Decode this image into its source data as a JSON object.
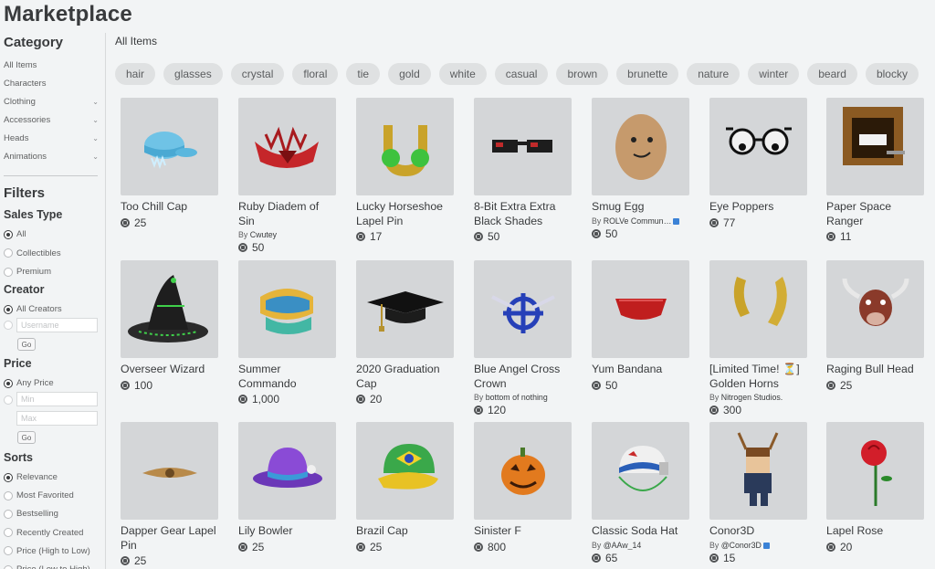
{
  "page": {
    "title": "Marketplace",
    "heading": "All Items"
  },
  "sidebar": {
    "category_title": "Category",
    "categories": [
      {
        "label": "All Items",
        "chevron": false
      },
      {
        "label": "Characters",
        "chevron": false
      },
      {
        "label": "Clothing",
        "chevron": true
      },
      {
        "label": "Accessories",
        "chevron": true
      },
      {
        "label": "Heads",
        "chevron": true
      },
      {
        "label": "Animations",
        "chevron": true
      }
    ],
    "filters_title": "Filters",
    "sales_type": {
      "title": "Sales Type",
      "options": [
        "All",
        "Collectibles",
        "Premium"
      ],
      "selected": "All"
    },
    "creator": {
      "title": "Creator",
      "options": [
        "All Creators"
      ],
      "selected": "All Creators",
      "username_placeholder": "Username",
      "go_label": "Go"
    },
    "price": {
      "title": "Price",
      "options": [
        "Any Price"
      ],
      "selected": "Any Price",
      "min_placeholder": "Min",
      "max_placeholder": "Max",
      "go_label": "Go"
    },
    "sorts": {
      "title": "Sorts",
      "options": [
        "Relevance",
        "Most Favorited",
        "Bestselling",
        "Recently Created",
        "Price (High to Low)",
        "Price (Low to High)"
      ],
      "selected": "Relevance"
    }
  },
  "tags": [
    "hair",
    "glasses",
    "crystal",
    "floral",
    "tie",
    "gold",
    "white",
    "casual",
    "brown",
    "brunette",
    "nature",
    "winter",
    "beard",
    "blocky"
  ],
  "items": [
    {
      "name": "Too Chill Cap",
      "creator": "",
      "price": "25",
      "icon": "cap-icon"
    },
    {
      "name": "Ruby Diadem of Sin",
      "creator": "Cwutey",
      "price": "50",
      "icon": "diadem-icon"
    },
    {
      "name": "Lucky Horseshoe Lapel Pin",
      "creator": "",
      "price": "17",
      "icon": "horseshoe-icon"
    },
    {
      "name": "8-Bit Extra Extra Black Shades",
      "creator": "",
      "price": "50",
      "icon": "shades-icon"
    },
    {
      "name": "Smug Egg",
      "creator": "ROLVe Commun…",
      "verified": true,
      "price": "50",
      "icon": "egg-icon"
    },
    {
      "name": "Eye Poppers",
      "creator": "",
      "price": "77",
      "icon": "glasses-icon"
    },
    {
      "name": "Paper Space Ranger",
      "creator": "",
      "price": "11",
      "icon": "box-helmet-icon"
    },
    {
      "name": "Overseer Wizard",
      "creator": "",
      "price": "100",
      "icon": "wizard-hat-icon"
    },
    {
      "name": "Summer Commando",
      "creator": "",
      "price": "1,000",
      "icon": "visor-icon"
    },
    {
      "name": "2020 Graduation Cap",
      "creator": "",
      "price": "20",
      "icon": "grad-cap-icon"
    },
    {
      "name": "Blue Angel Cross Crown",
      "creator": "bottom of nothing",
      "price": "120",
      "icon": "crown-icon"
    },
    {
      "name": "Yum Bandana",
      "creator": "",
      "price": "50",
      "icon": "bandana-icon"
    },
    {
      "name": "[Limited Time! ⏳] Golden Horns",
      "creator": "Nitrogen Studios.",
      "price": "300",
      "icon": "horns-icon"
    },
    {
      "name": "Raging Bull Head",
      "creator": "",
      "price": "25",
      "icon": "bull-icon"
    },
    {
      "name": "Dapper Gear Lapel Pin",
      "creator": "",
      "price": "25",
      "icon": "pin-icon"
    },
    {
      "name": "Lily Bowler",
      "creator": "",
      "price": "25",
      "icon": "bowler-icon"
    },
    {
      "name": "Brazil Cap",
      "creator": "",
      "price": "25",
      "icon": "brazil-cap-icon"
    },
    {
      "name": "Sinister F",
      "creator": "",
      "price": "800",
      "icon": "pumpkin-icon"
    },
    {
      "name": "Classic Soda Hat",
      "creator": "@AAw_14",
      "price": "65",
      "icon": "soda-hat-icon"
    },
    {
      "name": "Conor3D",
      "creator": "@Conor3D",
      "verified": true,
      "price": "15",
      "icon": "avatar-icon"
    },
    {
      "name": "Lapel Rose",
      "creator": "",
      "price": "20",
      "icon": "rose-icon"
    }
  ],
  "by_prefix": "By"
}
